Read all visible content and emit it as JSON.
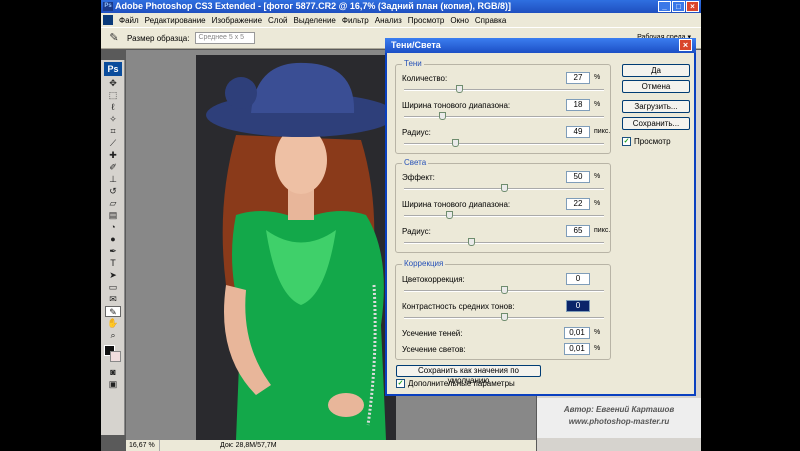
{
  "window": {
    "title": "Adobe Photoshop CS3 Extended - [фотог 5877.CR2 @ 16,7% (Задний план (копия), RGB/8)]",
    "app_icon": "Ps"
  },
  "menu": [
    "Файл",
    "Редактирование",
    "Изображение",
    "Слой",
    "Выделение",
    "Фильтр",
    "Анализ",
    "Просмотр",
    "Окно",
    "Справка"
  ],
  "options": {
    "sample_label": "Размер образца:",
    "sample_value": "Среднее 5 x 5",
    "workspace": "Рабочая среда ▾"
  },
  "toolbox": {
    "logo": "Ps"
  },
  "status": {
    "zoom": "16,67 %",
    "doc": "Док: 28,8М/57,7М"
  },
  "credits": {
    "line1": "Автор: Евгений Карташов",
    "line2": "www.photoshop-master.ru"
  },
  "dialog": {
    "title": "Тени/Света",
    "shadows": {
      "label": "Тени",
      "amount": {
        "label": "Количество:",
        "value": "27",
        "unit": "%",
        "level": 0.27
      },
      "tonal_width": {
        "label": "Ширина тонового диапазона:",
        "value": "18",
        "unit": "%",
        "level": 0.18
      },
      "radius": {
        "label": "Радиус:",
        "value": "49",
        "unit": "пикс.",
        "level": 0.25
      }
    },
    "highlights": {
      "label": "Света",
      "amount": {
        "label": "Эффект:",
        "value": "50",
        "unit": "%",
        "level": 0.5
      },
      "tonal_width": {
        "label": "Ширина тонового диапазона:",
        "value": "22",
        "unit": "%",
        "level": 0.22
      },
      "radius": {
        "label": "Радиус:",
        "value": "65",
        "unit": "пикс.",
        "level": 0.33
      }
    },
    "correction": {
      "label": "Коррекция",
      "color": {
        "label": "Цветокоррекция:",
        "value": "0",
        "level": 0.5
      },
      "midtone": {
        "label": "Контрастность средних тонов:",
        "value": "0",
        "level": 0.5
      },
      "clip_shadows": {
        "label": "Усечение теней:",
        "value": "0,01",
        "unit": "%"
      },
      "clip_highlights": {
        "label": "Усечение светов:",
        "value": "0,01",
        "unit": "%"
      }
    },
    "buttons": {
      "ok": "Да",
      "cancel": "Отмена",
      "load": "Загрузить...",
      "save": "Сохранить...",
      "save_default": "Сохранить как значения по умолчанию"
    },
    "preview": {
      "label": "Просмотр",
      "checked": true
    },
    "more_options": {
      "label": "Дополнительные параметры",
      "checked": true
    }
  }
}
